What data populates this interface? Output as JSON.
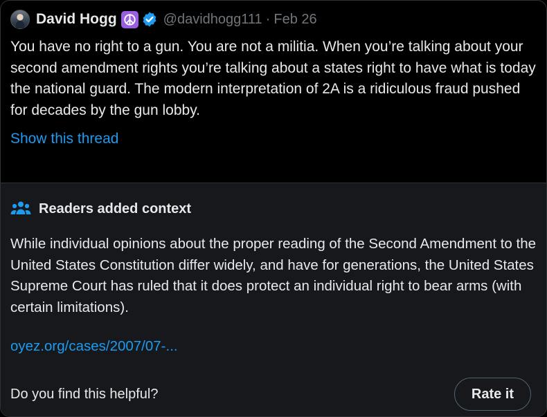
{
  "tweet": {
    "display_name": "David Hogg",
    "peace_emoji": "☮",
    "handle": "@davidhogg111",
    "separator": "·",
    "date": "Feb 26",
    "text": "You have no right to a gun. You are not a militia. When you’re talking about your second amendment rights you’re talking about a states right to have what is today the national guard. The modern interpretation of 2A is a ridiculous fraud pushed for decades by the gun lobby.",
    "show_thread": "Show this thread"
  },
  "note": {
    "title": "Readers added context",
    "body": "While individual opinions about the proper reading of the Second Amendment to the United States Constitution differ widely, and have for generations, the United States Supreme Court has ruled that it does protect an individual right to bear arms (with certain limitations).",
    "link": "oyez.org/cases/2007/07-...",
    "question": "Do you find this helpful?",
    "rate_label": "Rate it"
  },
  "icons": {
    "avatar": "profile-photo",
    "badge": "peace-symbol-icon",
    "verified": "verified-badge-icon",
    "note": "people-icon"
  },
  "colors": {
    "background": "#000000",
    "note_background": "#16181c",
    "text": "#e7e9ea",
    "secondary_text": "#71767b",
    "link": "#1d9bf0",
    "peace_badge": "#9a5fe0",
    "verified": "#1d9bf0"
  }
}
